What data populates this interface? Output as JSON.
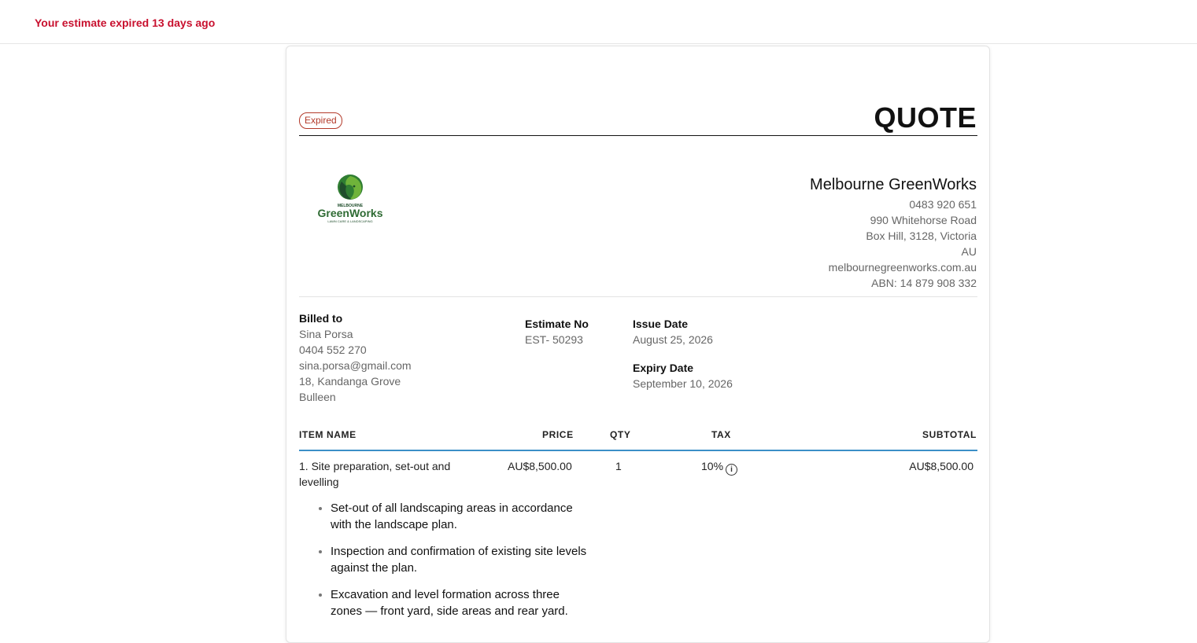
{
  "banner": {
    "expired_message": "Your estimate expired 13 days ago"
  },
  "document": {
    "status": "Expired",
    "title": "QUOTE"
  },
  "logo": {
    "top_text": "MELBOURNE",
    "brand": "GreenWorks",
    "tagline": "LAWN CARE & LANDSCAPING",
    "colors": {
      "green": "#2f7d32",
      "dark": "#1f4d2b",
      "light": "#6fb33a"
    }
  },
  "company": {
    "name": "Melbourne GreenWorks",
    "phone": "0483 920 651",
    "street": "990 Whitehorse Road",
    "city": "Box Hill, 3128, Victoria",
    "country": "AU",
    "website": "melbournegreenworks.com.au",
    "abn": "ABN: 14 879 908 332"
  },
  "billed_to": {
    "label": "Billed to",
    "name": "Sina Porsa",
    "phone": "0404 552 270",
    "email": "sina.porsa@gmail.com",
    "street": "18, Kandanga Grove",
    "suburb": "Bulleen"
  },
  "estimate": {
    "number_label": "Estimate No",
    "number": "EST- 50293",
    "issue_label": "Issue Date",
    "issue_date": "August 25, 2026",
    "expiry_label": "Expiry Date",
    "expiry_date": "September 10, 2026"
  },
  "table": {
    "headers": {
      "item": "ITEM NAME",
      "price": "PRICE",
      "qty": "QTY",
      "tax": "TAX",
      "subtotal": "SUBTOTAL"
    },
    "rows": [
      {
        "name": "1. Site preparation, set-out and levelling",
        "price": "AU$8,500.00",
        "qty": "1",
        "tax": "10%",
        "subtotal": "AU$8,500.00",
        "description": [
          "Set-out of all landscaping areas in accordance with the landscape plan.",
          "Inspection and confirmation of existing site levels against the plan.",
          "Excavation and level formation across three zones — front yard, side areas and rear yard."
        ]
      }
    ]
  },
  "colors": {
    "alert_red": "#c8102e",
    "status_border": "#b33a2a",
    "table_rule": "#3b8fc7"
  }
}
